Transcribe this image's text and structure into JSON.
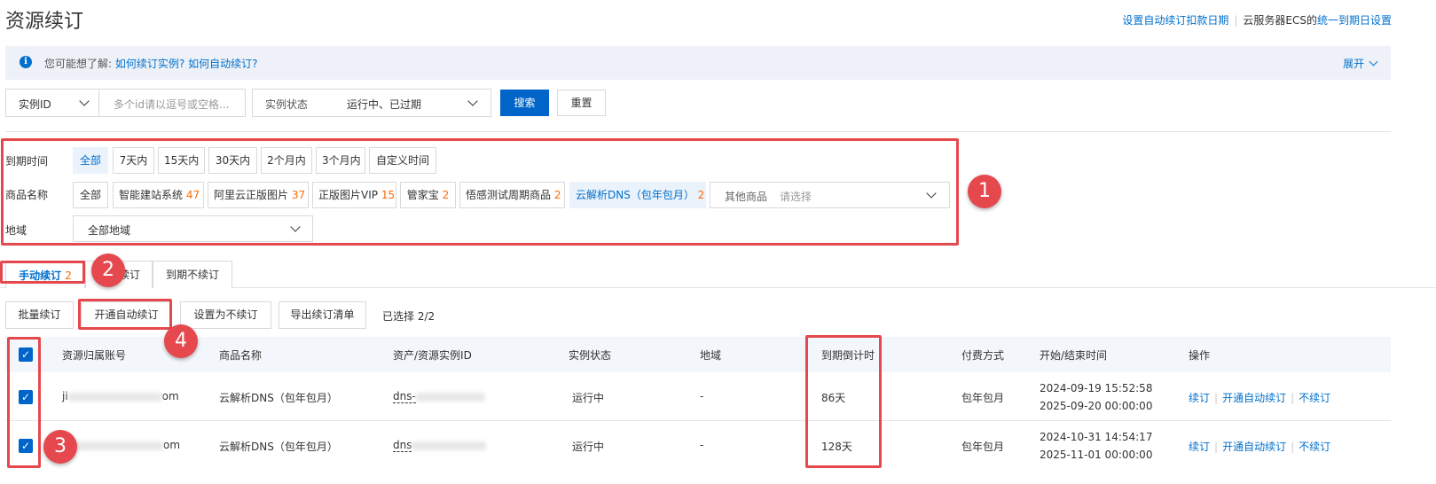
{
  "page": {
    "title": "资源续订"
  },
  "top_links": {
    "auto_renew_date": "设置自动续订扣款日期",
    "ecs_prefix": "云服务器ECS的",
    "unified_expiry": "统一到期日设置"
  },
  "info_bar": {
    "prefix": "您可能想了解:",
    "link1": "如何续订实例?",
    "link2": "如何自动续订?",
    "expand": "展开"
  },
  "search": {
    "field_select": "实例ID",
    "id_placeholder": "多个id请以逗号或空格...",
    "status_label": "实例状态",
    "status_value": "运行中、已过期",
    "search_btn": "搜索",
    "reset_btn": "重置"
  },
  "filters": {
    "expiry_label": "到期时间",
    "expiry_options": [
      "全部",
      "7天内",
      "15天内",
      "30天内",
      "2个月内",
      "3个月内",
      "自定义时间"
    ],
    "product_label": "商品名称",
    "products": [
      {
        "name": "全部",
        "count": ""
      },
      {
        "name": "智能建站系统",
        "count": "47"
      },
      {
        "name": "阿里云正版图片",
        "count": "37"
      },
      {
        "name": "正版图片VIP",
        "count": "15"
      },
      {
        "name": "管家宝",
        "count": "2"
      },
      {
        "name": "悟感测试周期商品",
        "count": "2"
      },
      {
        "name": "云解析DNS（包年包月）",
        "count": "2"
      }
    ],
    "other_label": "其他商品",
    "other_placeholder": "请选择",
    "region_label": "地域",
    "region_value": "全部地域"
  },
  "tabs": {
    "manual": "手动续订",
    "manual_count": "2",
    "auto_partial": "续订",
    "no_renew": "到期不续订"
  },
  "actions": {
    "batch": "批量续订",
    "enable_auto": "开通自动续订",
    "set_no_renew": "设置为不续订",
    "export": "导出续订清单",
    "selected": "已选择 2/2"
  },
  "table": {
    "headers": [
      "资源归属账号",
      "商品名称",
      "资产/资源实例ID",
      "实例状态",
      "地域",
      "到期倒计时",
      "付费方式",
      "开始/结束时间",
      "操作"
    ],
    "rows": [
      {
        "account_start": "ji",
        "account_end": "om",
        "product": "云解析DNS（包年包月）",
        "instance_prefix": "dns-",
        "status": "运行中",
        "region": "-",
        "countdown": "86天",
        "pay": "包年包月",
        "start": "2024-09-19 15:52:58",
        "end": "2025-09-20 00:00:00",
        "op1": "续订",
        "op2": "开通自动续订",
        "op3": "不续订"
      },
      {
        "account_start": "",
        "account_end": "om",
        "product": "云解析DNS（包年包月）",
        "instance_prefix": "dns",
        "status": "运行中",
        "region": "-",
        "countdown": "128天",
        "pay": "包年包月",
        "start": "2024-10-31 14:54:17",
        "end": "2025-11-01 00:00:00",
        "op1": "续订",
        "op2": "开通自动续订",
        "op3": "不续订"
      }
    ]
  },
  "annotations": [
    "1",
    "2",
    "3",
    "4"
  ],
  "colors": {
    "primary": "#0064c8",
    "link": "#0070cc",
    "highlight": "#e5484d",
    "count": "#ff6a00"
  }
}
